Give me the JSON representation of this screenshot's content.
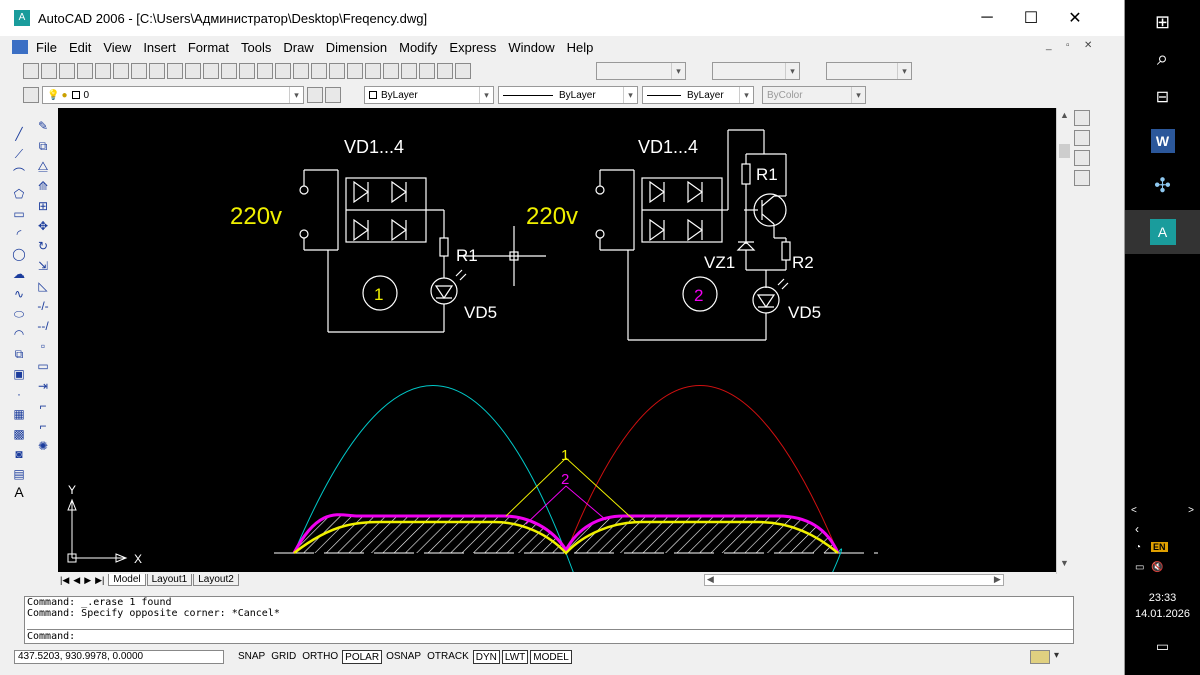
{
  "window": {
    "title": "AutoCAD 2006 - [C:\\Users\\Администратор\\Desktop\\Freqency.dwg]",
    "minimize": "─",
    "maximize": "☐",
    "close": "✕"
  },
  "menu": [
    "File",
    "Edit",
    "View",
    "Insert",
    "Format",
    "Tools",
    "Draw",
    "Dimension",
    "Modify",
    "Express",
    "Window",
    "Help"
  ],
  "layer_combo": "0",
  "properties": {
    "color": "ByLayer",
    "linetype": "ByLayer",
    "lineweight": "ByLayer",
    "plotstyle": "ByColor"
  },
  "drawing": {
    "circuit1": {
      "diodes_label": "VD1...4",
      "voltage": "220v",
      "resistor": "R1",
      "led": "VD5",
      "number": "1"
    },
    "circuit2": {
      "diodes_label": "VD1...4",
      "voltage": "220v",
      "resistor1": "R1",
      "resistor2": "R2",
      "zener": "VZ1",
      "led": "VD5",
      "number": "2"
    },
    "curve_label_1": "1",
    "curve_label_2": "2",
    "ucs_y": "Y",
    "ucs_x": "X",
    "colors": {
      "cyan": "#00c8c8",
      "red": "#d01010",
      "yellow": "#f0f000",
      "magenta": "#f000f0",
      "white": "#ffffff"
    }
  },
  "tabs": [
    "Model",
    "Layout1",
    "Layout2"
  ],
  "command_lines": [
    "Command: _.erase 1 found",
    "Command: Specify opposite corner: *Cancel*"
  ],
  "command_prompt": "Command:",
  "coordinates": "437.5203, 930.9978, 0.0000",
  "status_buttons": [
    {
      "label": "SNAP",
      "on": false
    },
    {
      "label": "GRID",
      "on": false
    },
    {
      "label": "ORTHO",
      "on": false
    },
    {
      "label": "POLAR",
      "on": true
    },
    {
      "label": "OSNAP",
      "on": false
    },
    {
      "label": "OTRACK",
      "on": false
    },
    {
      "label": "DYN",
      "on": true
    },
    {
      "label": "LWT",
      "on": true
    },
    {
      "label": "MODEL",
      "on": true
    }
  ],
  "taskbar": {
    "lang": "EN",
    "time": "23:33",
    "date": "14.01.2026"
  }
}
